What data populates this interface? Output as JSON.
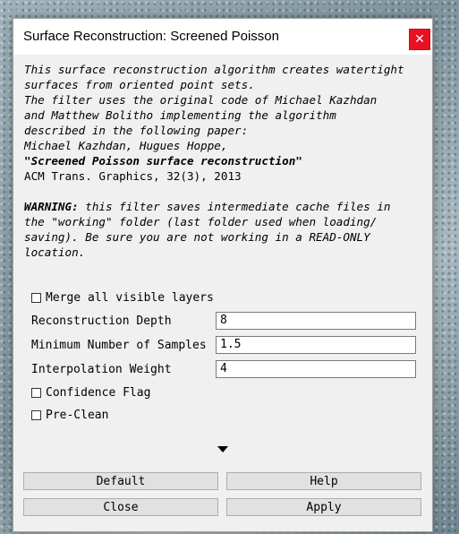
{
  "dialog": {
    "title": "Surface Reconstruction: Screened Poisson",
    "close_glyph": "✕",
    "description": {
      "line1": "This surface reconstruction algorithm creates watertight",
      "line2": "surfaces from oriented point sets.",
      "line3": "The filter uses the original code of Michael Kazhdan",
      "line4": "and Matthew Bolitho implementing the algorithm",
      "line5": "described in the following paper:",
      "line6": "Michael Kazhdan, Hugues Hoppe,",
      "paper_title": "\"Screened Poisson surface reconstruction\"",
      "citation": "ACM Trans. Graphics, 32(3), 2013"
    },
    "warning": {
      "label": "WARNING:",
      "line1": " this filter saves intermediate cache files in",
      "line2": "the \"working\" folder (last folder used when loading/",
      "line3": "saving). Be sure you are not working in a READ-ONLY",
      "line4": "location."
    },
    "params": {
      "merge_layers": {
        "label": "Merge all visible layers",
        "checked": false
      },
      "reconstruction_depth": {
        "label": "Reconstruction Depth",
        "value": "8"
      },
      "min_samples": {
        "label": "Minimum Number of Samples",
        "value": "1.5"
      },
      "interpolation_weight": {
        "label": "Interpolation Weight",
        "value": "4"
      },
      "confidence_flag": {
        "label": "Confidence Flag",
        "checked": false
      },
      "pre_clean": {
        "label": "Pre-Clean",
        "checked": false
      }
    },
    "buttons": {
      "default": "Default",
      "help": "Help",
      "close": "Close",
      "apply": "Apply"
    }
  }
}
